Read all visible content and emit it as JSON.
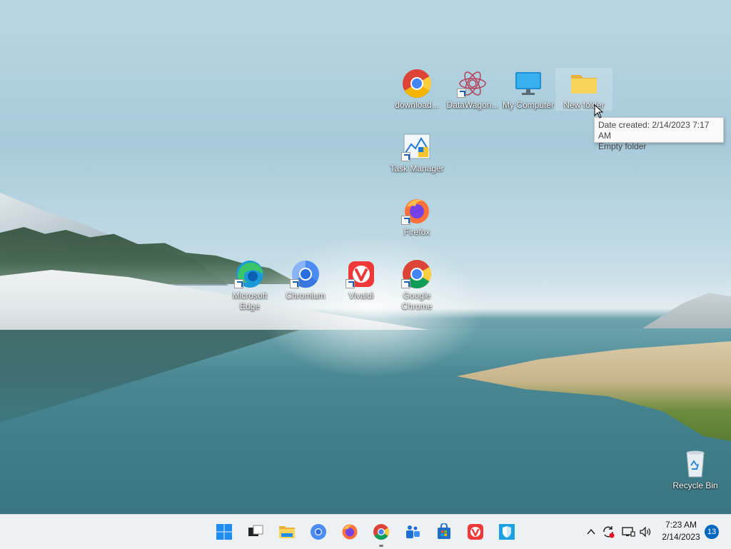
{
  "desktop_icons": [
    {
      "id": "downloads",
      "label": "download..."
    },
    {
      "id": "datawagon",
      "label": "DataWagon..."
    },
    {
      "id": "my-computer",
      "label": "My Computer"
    },
    {
      "id": "new-folder",
      "label": "New folder"
    },
    {
      "id": "task-manager",
      "label": "Task Manager"
    },
    {
      "id": "firefox",
      "label": "Firefox"
    },
    {
      "id": "edge",
      "label": "Microsoft Edge"
    },
    {
      "id": "chromium",
      "label": "Chromium"
    },
    {
      "id": "vivaldi",
      "label": "Vivaldi"
    },
    {
      "id": "google-chrome",
      "label": "Google Chrome"
    },
    {
      "id": "recycle-bin",
      "label": "Recycle Bin"
    }
  ],
  "tooltip": {
    "line1": "Date created: 2/14/2023 7:17 AM",
    "line2": "Empty folder"
  },
  "taskbar": {
    "apps": [
      "start-icon",
      "task-view-icon",
      "file-explorer-icon",
      "chromium-icon",
      "firefox-icon",
      "chrome-icon",
      "teams-icon",
      "store-icon",
      "vivaldi-icon",
      "defender-icon"
    ],
    "active_app": "chrome-icon"
  },
  "tray": {
    "time": "7:23 AM",
    "date": "2/14/2023",
    "notifications": "13"
  },
  "colors": {
    "taskbar_bg": "#eef1f4",
    "accent": "#0067c0"
  }
}
